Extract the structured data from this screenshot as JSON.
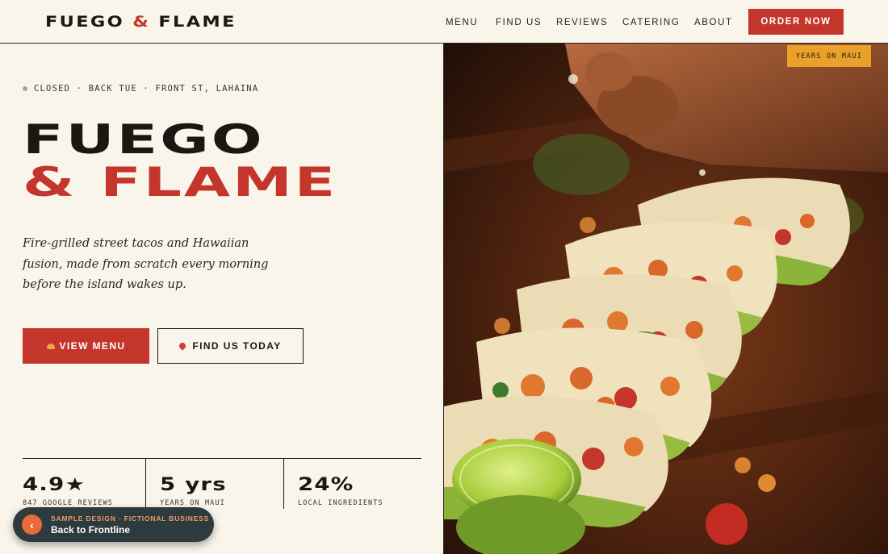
{
  "brand": {
    "name_part1": "FUEGO",
    "amp": "&",
    "name_part2": "FLAME"
  },
  "nav": {
    "items": [
      {
        "label": "MENU"
      },
      {
        "label": "FIND US"
      },
      {
        "label": "REVIEWS"
      },
      {
        "label": "CATERING"
      },
      {
        "label": "ABOUT"
      }
    ],
    "order_label": "ORDER NOW"
  },
  "hero": {
    "status": "CLOSED · BACK TUE · FRONT ST, LAHAINA",
    "title_line1": "FUEGO",
    "title_line2": "& FLAME",
    "tagline": "Fire-grilled street tacos and Hawaiian fusion, made from scratch every morning before the island wakes up.",
    "primary_button": "VIEW MENU",
    "secondary_button": "FIND US TODAY"
  },
  "stats": [
    {
      "value": "4.9★",
      "label": "847 GOOGLE REVIEWS"
    },
    {
      "value": "5 yrs",
      "label": "YEARS ON MAUI"
    },
    {
      "value": "24%",
      "label": "LOCAL INGREDIENTS"
    }
  ],
  "photo": {
    "badge": "YEARS ON MAUI"
  },
  "back_pill": {
    "top_text": "SAMPLE DESIGN · FICTIONAL BUSINESS",
    "main_text": "Back to Frontline",
    "icon": "chevron-left-icon"
  },
  "colors": {
    "accent": "#c4352b",
    "background": "#faf5ea",
    "badge": "#e9a12c",
    "ink": "#1c1712"
  }
}
